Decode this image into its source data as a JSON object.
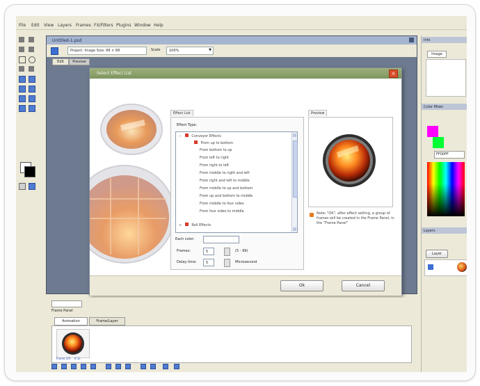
{
  "menu": {
    "items": [
      "File",
      "Edit",
      "View",
      "Layers",
      "Frames",
      "FX/Filters",
      "Plugins",
      "Window",
      "Help"
    ]
  },
  "document": {
    "title": "Untitled-1.psd",
    "project_label": "Project: Image Size: 88 × 88",
    "scale_label": "Scale",
    "scale_value": "100%",
    "tab_labels": [
      "Edit",
      "Preview"
    ]
  },
  "dialog": {
    "title": "Select Effect List",
    "close_glyph": "×",
    "effect_tab_label": "Effect List",
    "effect_type_label": "Effect Type:",
    "tree_items": [
      "Conveyor Effects",
      "From up to bottom",
      "From bottom to up",
      "From left to right",
      "From right to left",
      "From middle to right and left",
      "From right and left to middle",
      "From middle to up and bottom",
      "From up and bottom to middle",
      "From middle to four sides",
      "From four sides to middle",
      "Roll Effects"
    ],
    "each_color_label": "Each color:",
    "frames_label": "Frames:",
    "frames_value": "5",
    "frames_range": "(5 - 99)",
    "delay_label": "Delay time:",
    "delay_value": "5",
    "delay_unit": "Microsecond",
    "preview_tab_label": "Preview",
    "note_text": "Note: \"OK\", after effect setting, a group of frames will be created in the Frame Panel, in the \"Frame Panel\"",
    "ok_label": "Ok",
    "cancel_label": "Cancel"
  },
  "right_panel": {
    "section_titles": [
      "Info",
      "Color Mixer",
      "Layers"
    ],
    "image_tab_label": "Image",
    "layer_button_label": "Layer",
    "color_value": "FF00FF"
  },
  "bottom_panel": {
    "tabs": [
      "Frame Panel"
    ],
    "subtabs": [
      "Animation",
      "Frame/Layer"
    ],
    "thumb_caption": "Frame 1/5",
    "thumb_time": "0.1s"
  },
  "colors": {
    "dialog_title": "#8aa06a",
    "doc_bg": "#6d7a8f",
    "chrome": "#ece9d8",
    "accent_blue": "#4f7bd1",
    "magenta": "#ff00ff",
    "green": "#00ff33"
  }
}
